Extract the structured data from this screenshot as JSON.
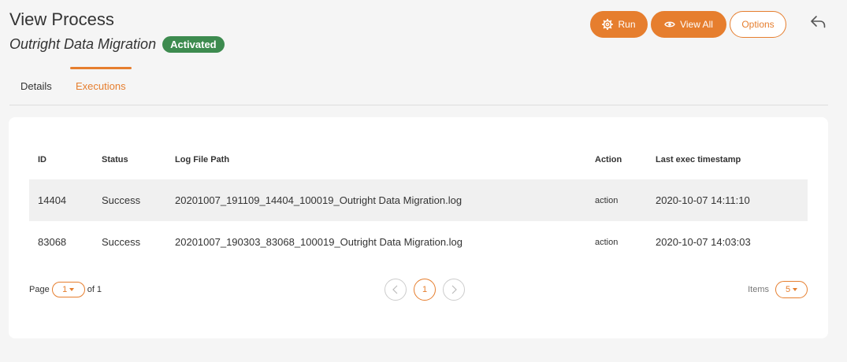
{
  "header": {
    "title": "View Process",
    "process_name": "Outright Data Migration",
    "status_badge": "Activated"
  },
  "toolbar": {
    "run_label": "Run",
    "view_all_label": "View All",
    "options_label": "Options"
  },
  "tabs": [
    {
      "label": "Details",
      "active": false
    },
    {
      "label": "Executions",
      "active": true
    }
  ],
  "table": {
    "columns": [
      "ID",
      "Status",
      "Log File Path",
      "Action",
      "Last exec timestamp"
    ],
    "rows": [
      {
        "id": "14404",
        "status": "Success",
        "path": "20201007_191109_14404_100019_Outright Data Migration.log",
        "action": "action",
        "timestamp": "2020-10-07 14:11:10"
      },
      {
        "id": "83068",
        "status": "Success",
        "path": "20201007_190303_83068_100019_Outright Data Migration.log",
        "action": "action",
        "timestamp": "2020-10-07 14:03:03"
      }
    ]
  },
  "pager": {
    "page_label": "Page",
    "current_page": "1",
    "of_label": "of 1",
    "page_button": "1",
    "items_label": "Items",
    "items_per_page": "5"
  },
  "colors": {
    "accent": "#e67e2e",
    "badge": "#3d8b4f"
  }
}
